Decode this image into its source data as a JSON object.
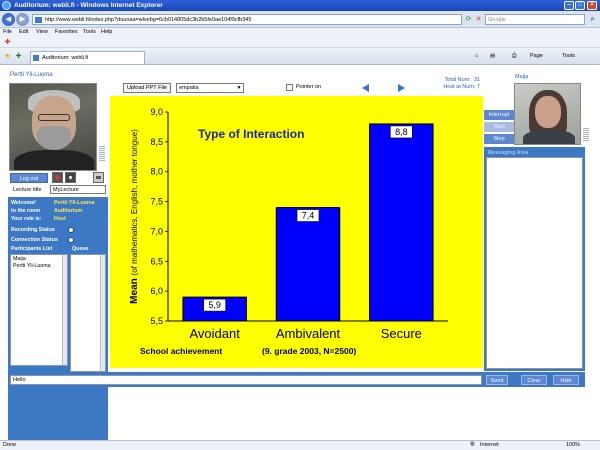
{
  "window": {
    "title": "Auditorium: webli.fi - Windows Internet Explorer",
    "url": "http://www.webli.fi/index.php?duunaa=wlvebg=6cb014805dc3b2b5fe0ae104f9cfb345",
    "search_placeholder": "Google",
    "minimize": "–",
    "maximize": "□",
    "close": "×"
  },
  "menu": [
    "File",
    "Edit",
    "View",
    "Favorites",
    "Tools",
    "Help"
  ],
  "tab": {
    "label": "Auditorium: webli.fi"
  },
  "commands": {
    "page": "Page",
    "tools": "Tools"
  },
  "left": {
    "user_name": "Pertti Yli-Luoma",
    "logout": "Log out",
    "lecture_title_label": "Lecture title",
    "lecture_title_value": "MyLecture",
    "status": {
      "welcome_label": "Welcome!",
      "welcome_value": "Pertti Yli-Luoma",
      "room_label": "to the room",
      "room_value": "Auditorium",
      "role_label": "Your role is:",
      "role_value": "Host",
      "recording_label": "Recording Status",
      "connection_label": "Connection Status",
      "participants_label": "Participants List",
      "queue_label": "Queue"
    },
    "participants": [
      "Maija",
      "Pertti Yli-Luoma"
    ]
  },
  "toolbar": {
    "upload": "Upload PPT File",
    "file_selected": "empatia",
    "pointer_label": "Pointer on",
    "total_label": "Total Num:",
    "total_value": "31",
    "host_label": "Host at Num:",
    "host_value": "7"
  },
  "right": {
    "user_name": "Maija",
    "interrupt": "Interrupt",
    "start": "Start",
    "stop": "Stop",
    "messaging_label": "Messaging Area"
  },
  "chat": {
    "input_value": "Hello",
    "send": "Send",
    "clear": "Clear",
    "hide": "Hide"
  },
  "statusbar": {
    "left": "Done",
    "zone": "Internet",
    "zoom": "100%"
  },
  "colors": {
    "slide_bg": "#ffff00",
    "bar_fill": "#0000ff",
    "title_text": "#1a2b8c",
    "panel_blue": "#3c78c4"
  },
  "chart_data": {
    "type": "bar",
    "title": "Type of Interaction",
    "categories": [
      "Avoidant",
      "Ambivalent",
      "Secure"
    ],
    "values": [
      5.9,
      7.4,
      8.8
    ],
    "data_labels": [
      "5,9",
      "7,4",
      "8,8"
    ],
    "ylabel_bold": "Mean",
    "ylabel_rest": "(of mathematics, English, mother tongue)",
    "xlabel": "School achievement",
    "xlabel_note": "(9. grade 2003, N=2500)",
    "ylim": [
      5.5,
      9.0
    ],
    "yticks": [
      "5,5",
      "6,0",
      "6,5",
      "7,0",
      "7,5",
      "8,0",
      "8,5",
      "9,0"
    ],
    "ytick_values": [
      5.5,
      6.0,
      6.5,
      7.0,
      7.5,
      8.0,
      8.5,
      9.0
    ]
  }
}
